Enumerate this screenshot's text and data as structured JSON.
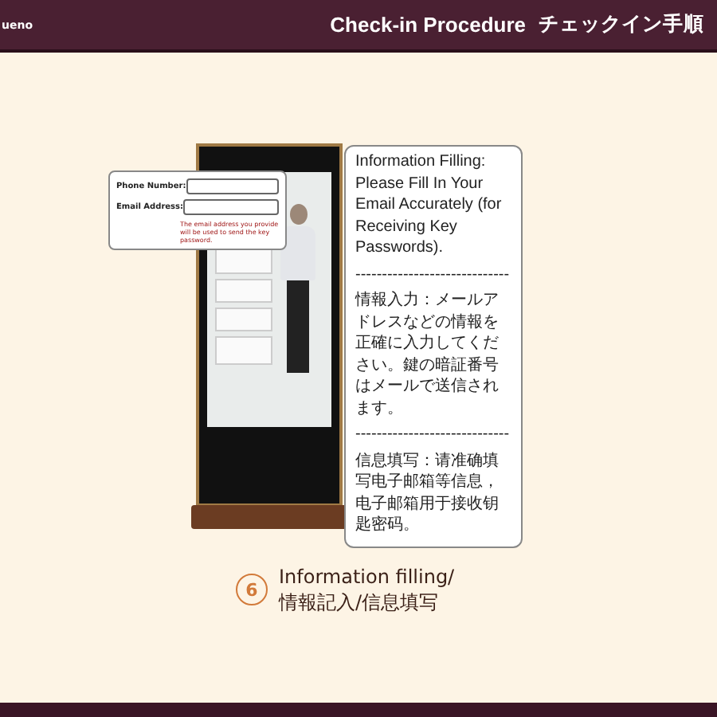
{
  "header": {
    "brand": "ueno",
    "title_en": "Check-in Procedure",
    "title_ja": "チェックイン手順"
  },
  "form_popup": {
    "fields": [
      {
        "label": "Phone Number:"
      },
      {
        "label": "Email Address:"
      }
    ],
    "note": "The email address you provide will be used to send the key password."
  },
  "info_box": {
    "paragraphs": [
      "Information Filling: Please Fill In Your Email Accurately (for Receiving Key Passwords).",
      "-----------------------------",
      "情報入力：メールアドレスなどの情報を正確に入力してください。鍵の暗証番号はメールで送信されます。",
      "-----------------------------",
      "信息填写：请准确填写电子邮箱等信息，电子邮箱用于接收钥匙密码。"
    ]
  },
  "step": {
    "number": "6",
    "lines": [
      "Information filling/",
      "情報記入/信息填写"
    ]
  }
}
